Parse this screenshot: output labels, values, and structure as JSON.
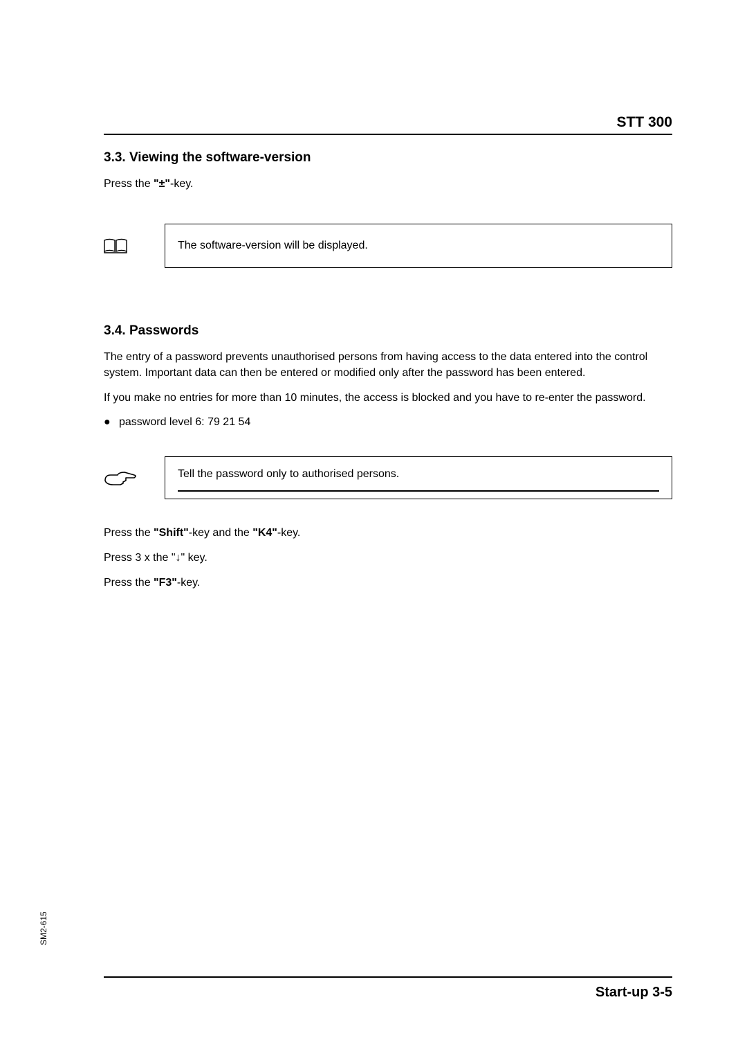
{
  "header": {
    "doc_title": "STT 300"
  },
  "section33": {
    "heading": "3.3. Viewing the software-version",
    "press_line_prefix": "Press the ",
    "key_label": "\"±\"",
    "press_line_suffix": "-key.",
    "callout_text": "The software-version will be displayed."
  },
  "section34": {
    "heading": "3.4. Passwords",
    "para1": "The entry of a password prevents unauthorised persons from having access to the data entered into the control system. Important data can then be entered or modified only after the password has been entered.",
    "para2": "If you make no entries for more than 10 minutes, the access is blocked and you have to re-enter the password.",
    "bullet_item": "password level 6: 79 21 54",
    "tip_text": "Tell the password only to authorised persons.",
    "press_shift_prefix": "Press the ",
    "shift_label": "\"Shift\"",
    "press_shift_mid": "-key and the ",
    "k4_label": "\"K4\"",
    "press_shift_suffix": "-key.",
    "press_down": "Press 3 x the \"↓\" key.",
    "press_f3_prefix": "Press the ",
    "f3_label": "\"F3\"",
    "press_f3_suffix": "-key."
  },
  "icons": {
    "book": "book-icon",
    "hand": "pointing-hand-icon"
  },
  "side_label": "SM2-615",
  "footer": {
    "page_label": "Start-up 3-5"
  }
}
